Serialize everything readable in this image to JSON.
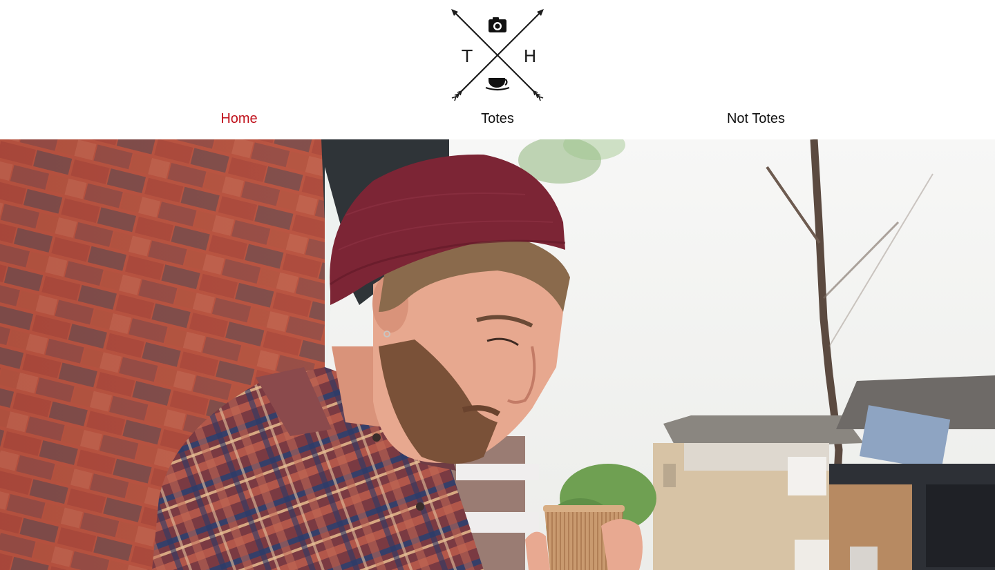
{
  "brand": {
    "logo_left_letter": "T",
    "logo_right_letter": "H",
    "logo_top_icon": "camera-icon",
    "logo_bottom_icon": "coffee-cup-icon"
  },
  "nav": {
    "items": [
      {
        "label": "Home",
        "active": true
      },
      {
        "label": "Totes",
        "active": false
      },
      {
        "label": "Not Totes",
        "active": false
      }
    ]
  },
  "colors": {
    "active_link": "#c0111b",
    "link": "#111111",
    "background": "#ffffff"
  }
}
